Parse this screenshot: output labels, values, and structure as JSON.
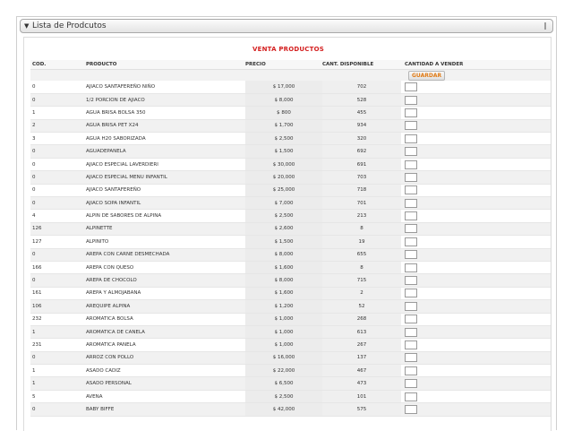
{
  "panel": {
    "toggle_icon": "▼",
    "title": "Lista de Prodcutos",
    "grip_icon": "‖"
  },
  "form": {
    "title": "VENTA PRODUCTOS",
    "save_label": "GUARDAR"
  },
  "table": {
    "columns": [
      "COD.",
      "PRODUCTO",
      "PRECIO",
      "CANT. DISPONIBLE",
      "CANTIDAD A VENDER"
    ],
    "rows": [
      {
        "code": "0",
        "product": "AJIACO SANTAFEREÑO NIÑO",
        "price": "$ 17,000",
        "stock": "702"
      },
      {
        "code": "0",
        "product": "1/2 PORCION DE AJIACO",
        "price": "$ 8,000",
        "stock": "528"
      },
      {
        "code": "1",
        "product": "AGUA BRISA BOLSA 350",
        "price": "$ 800",
        "stock": "455"
      },
      {
        "code": "2",
        "product": "AGUA BRISA PET X24",
        "price": "$ 1,700",
        "stock": "934"
      },
      {
        "code": "3",
        "product": "AGUA H20 SABORIZADA",
        "price": "$ 2,500",
        "stock": "320"
      },
      {
        "code": "0",
        "product": "AGUADEPANELA",
        "price": "$ 1,500",
        "stock": "692"
      },
      {
        "code": "0",
        "product": "AJIACO ESPECIAL LAVERDIERI",
        "price": "$ 30,000",
        "stock": "691"
      },
      {
        "code": "0",
        "product": "AJIACO ESPECIAL MENU INFANTIL",
        "price": "$ 20,000",
        "stock": "703"
      },
      {
        "code": "0",
        "product": "AJIACO SANTAFEREÑO",
        "price": "$ 25,000",
        "stock": "718"
      },
      {
        "code": "0",
        "product": "AJIACO SOPA INFANTIL",
        "price": "$ 7,000",
        "stock": "701"
      },
      {
        "code": "4",
        "product": "ALPIN DE SABORES DE ALPINA",
        "price": "$ 2,500",
        "stock": "213"
      },
      {
        "code": "126",
        "product": "ALPINETTE",
        "price": "$ 2,600",
        "stock": "8"
      },
      {
        "code": "127",
        "product": "ALPINITO",
        "price": "$ 1,500",
        "stock": "19"
      },
      {
        "code": "0",
        "product": "AREPA CON CARNE DESMECHADA",
        "price": "$ 8,000",
        "stock": "655"
      },
      {
        "code": "166",
        "product": "AREPA CON QUESO",
        "price": "$ 1,600",
        "stock": "8"
      },
      {
        "code": "0",
        "product": "AREPA DE CHOCOLO",
        "price": "$ 8,000",
        "stock": "715"
      },
      {
        "code": "161",
        "product": "AREPA Y ALMOJABANA",
        "price": "$ 1,600",
        "stock": "2"
      },
      {
        "code": "106",
        "product": "AREQUIPE ALPINA",
        "price": "$ 1,200",
        "stock": "52"
      },
      {
        "code": "232",
        "product": "AROMATICA BOLSA",
        "price": "$ 1,000",
        "stock": "268"
      },
      {
        "code": "1",
        "product": "AROMATICA DE CANELA",
        "price": "$ 1,000",
        "stock": "613"
      },
      {
        "code": "231",
        "product": "AROMATICA PANELA",
        "price": "$ 1,000",
        "stock": "267"
      },
      {
        "code": "0",
        "product": "ARROZ CON POLLO",
        "price": "$ 16,000",
        "stock": "137"
      },
      {
        "code": "1",
        "product": "ASADO CADIZ",
        "price": "$ 22,000",
        "stock": "467"
      },
      {
        "code": "1",
        "product": "ASADO PERSONAL",
        "price": "$ 6,500",
        "stock": "473"
      },
      {
        "code": "5",
        "product": "AVENA",
        "price": "$ 2,500",
        "stock": "101"
      },
      {
        "code": "0",
        "product": "BABY BIFFE",
        "price": "$ 42,000",
        "stock": "575"
      }
    ]
  }
}
